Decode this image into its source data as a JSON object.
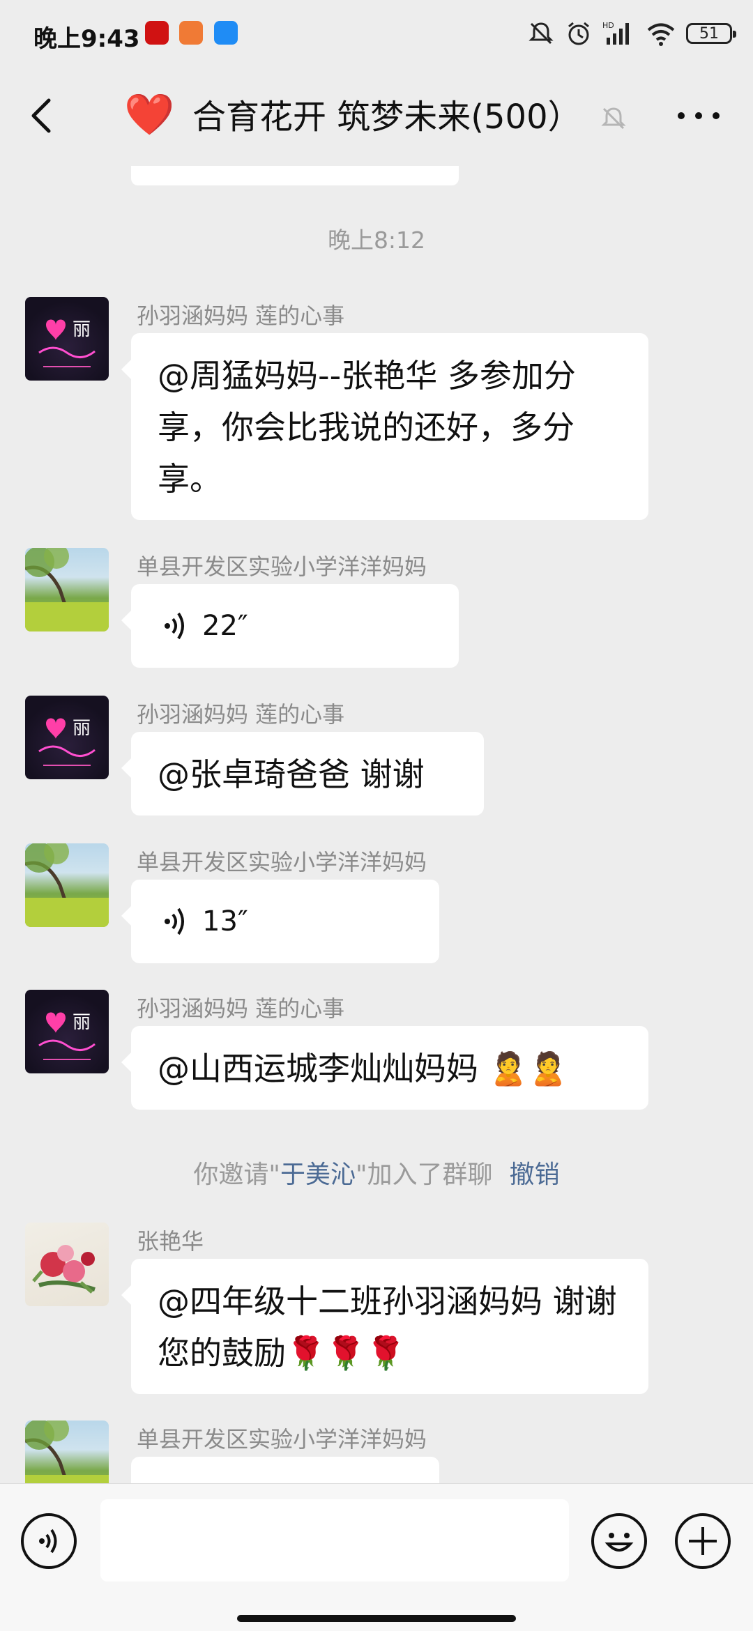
{
  "status_bar": {
    "time": "晚上9:43",
    "battery": "51",
    "badges": [
      "app-red",
      "app-orange",
      "app-blue"
    ],
    "icons": [
      "mute-bell-icon",
      "alarm-icon",
      "hd-signal-icon",
      "wifi-icon",
      "battery-icon"
    ]
  },
  "nav": {
    "title": "合育花开 筑梦未来(500）",
    "title_emoji": "❤️",
    "icons": [
      "back-arrow-icon",
      "mute-bell-icon",
      "more-dots-icon"
    ]
  },
  "chat": {
    "timestamp": "晚上8:12",
    "messages": [
      {
        "sender": "孙羽涵妈妈  莲的心事",
        "avatar": "neon-heart-avatar",
        "type": "text",
        "text": "@周猛妈妈--张艳华  多参加分享，你会比我说的还好，多分享。"
      },
      {
        "sender": "单县开发区实验小学洋洋妈妈",
        "avatar": "nature-tree-avatar",
        "type": "voice",
        "duration": "22″"
      },
      {
        "sender": "孙羽涵妈妈  莲的心事",
        "avatar": "neon-heart-avatar",
        "type": "text",
        "text": "@张卓琦爸爸  谢谢"
      },
      {
        "sender": "单县开发区实验小学洋洋妈妈",
        "avatar": "nature-tree-avatar",
        "type": "voice",
        "duration": "13″"
      },
      {
        "sender": "孙羽涵妈妈  莲的心事",
        "avatar": "neon-heart-avatar",
        "type": "text",
        "text": "@山西运城李灿灿妈妈  🙎🙎"
      },
      {
        "sender": "张艳华",
        "avatar": "peony-painting-avatar",
        "type": "text",
        "text": "@四年级十二班孙羽涵妈妈  谢谢您的鼓励🌹🌹🌹"
      },
      {
        "sender": "单县开发区实验小学洋洋妈妈",
        "avatar": "nature-tree-avatar",
        "type": "partial"
      }
    ],
    "system_notice": {
      "prefix": "你邀请\"",
      "name": "于美沁",
      "suffix": "\"加入了群聊",
      "action": "撤销"
    }
  },
  "input_bar": {
    "value": "",
    "icons": [
      "voice-toggle-icon",
      "emoji-icon",
      "plus-icon"
    ]
  }
}
